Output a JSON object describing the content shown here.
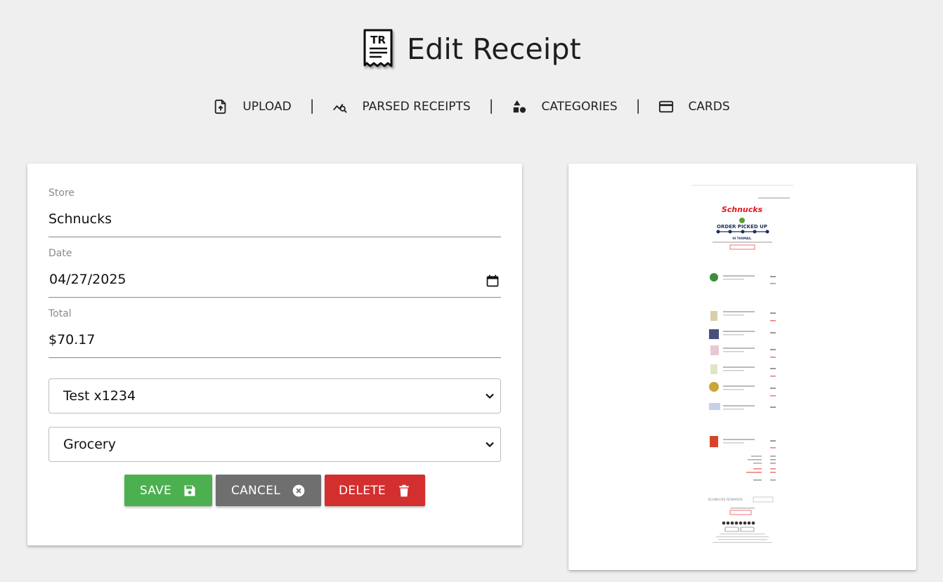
{
  "header": {
    "logo_text": "TR",
    "title": "Edit Receipt"
  },
  "nav": {
    "items": [
      {
        "label": "UPLOAD",
        "icon": "upload-file-icon"
      },
      {
        "label": "PARSED RECEIPTS",
        "icon": "search-chart-icon"
      },
      {
        "label": "CATEGORIES",
        "icon": "shapes-icon"
      },
      {
        "label": "CARDS",
        "icon": "credit-card-icon"
      }
    ],
    "separator": "|"
  },
  "form": {
    "store_label": "Store",
    "store_value": "Schnucks",
    "date_label": "Date",
    "date_value": "04/27/2025",
    "total_label": "Total",
    "total_value": "$70.17",
    "card_select": "Test x1234",
    "category_select": "Grocery",
    "save_label": "SAVE",
    "cancel_label": "CANCEL",
    "delete_label": "DELETE"
  },
  "receipt_preview": {
    "brand": "Schnucks",
    "heading": "ORDER PICKED UP",
    "greeting": "HI THOMAS,",
    "rewards": "SCHNUCKS REWARDS"
  },
  "colors": {
    "save": "#4caf50",
    "cancel": "#6f6f6f",
    "delete": "#d32f2f",
    "brand_red": "#e3161b"
  }
}
